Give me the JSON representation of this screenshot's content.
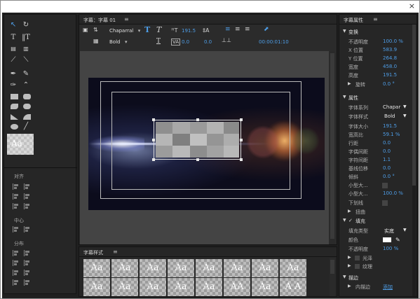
{
  "window": {
    "close_glyph": "×"
  },
  "title_panel": {
    "tab_label": "字幕：字幕 01",
    "menu_glyph": "≡",
    "font_family": "Chaparral",
    "font_style": "Bold",
    "font_size": "191.5",
    "kerning": "0.0",
    "leading": "0.0",
    "timecode": "00:00:01:10"
  },
  "styles_panel": {
    "tab_label": "字幕样式",
    "menu_glyph": "≡",
    "swatches_row1": [
      "Aa",
      "Aa",
      "Aa",
      "Aa",
      "Aa",
      "Aa",
      "Aa",
      "Aa"
    ],
    "swatches_row2": [
      "Aa",
      "Aa",
      "Aa",
      "Aa",
      "Aa",
      "AA",
      "Aa",
      "A A"
    ]
  },
  "tools_panel": {
    "align_label": "对齐",
    "center_label": "中心",
    "distribute_label": "分布",
    "preview_text": "Aa"
  },
  "properties": {
    "tab_label": "字幕属性",
    "menu_glyph": "≡",
    "transform": {
      "label": "变换",
      "opacity_label": "不透明度",
      "opacity": "100.0 %",
      "x_label": "X 位置",
      "x": "583.9",
      "y_label": "Y 位置",
      "y": "264.8",
      "width_label": "宽度",
      "width": "458.0",
      "height_label": "高度",
      "height": "191.5",
      "rotation_label": "旋转",
      "rotation": "0.0 °"
    },
    "attributes": {
      "label": "属性",
      "family_label": "字体系列",
      "family": "Chapar",
      "style_label": "字体样式",
      "style": "Bold",
      "size_label": "字体大小",
      "size": "191.5",
      "aspect_label": "宽高比",
      "aspect": "59.1 %",
      "leading_label": "行距",
      "leading": "0.0",
      "kerning_label": "字偶间距",
      "kerning": "0.0",
      "tracking_label": "字符间距",
      "tracking": "1.1",
      "baseline_label": "基线位移",
      "baseline": "0.0",
      "slant_label": "倾斜",
      "slant": "0.0 °",
      "smallcaps_label": "小型大...",
      "smallcaps_size_label": "小型大...",
      "smallcaps_size": "100.0 %",
      "underline_label": "下划线",
      "distort_label": "扭曲"
    },
    "fill": {
      "label": "填充",
      "type_label": "填充类型",
      "type": "实底",
      "color_label": "颜色",
      "opacity_label": "不透明度",
      "opacity": "100 %",
      "sheen_label": "光泽",
      "texture_label": "纹理"
    },
    "stroke": {
      "label": "描边",
      "inner_label": "内描边",
      "add_label": "添加"
    }
  }
}
